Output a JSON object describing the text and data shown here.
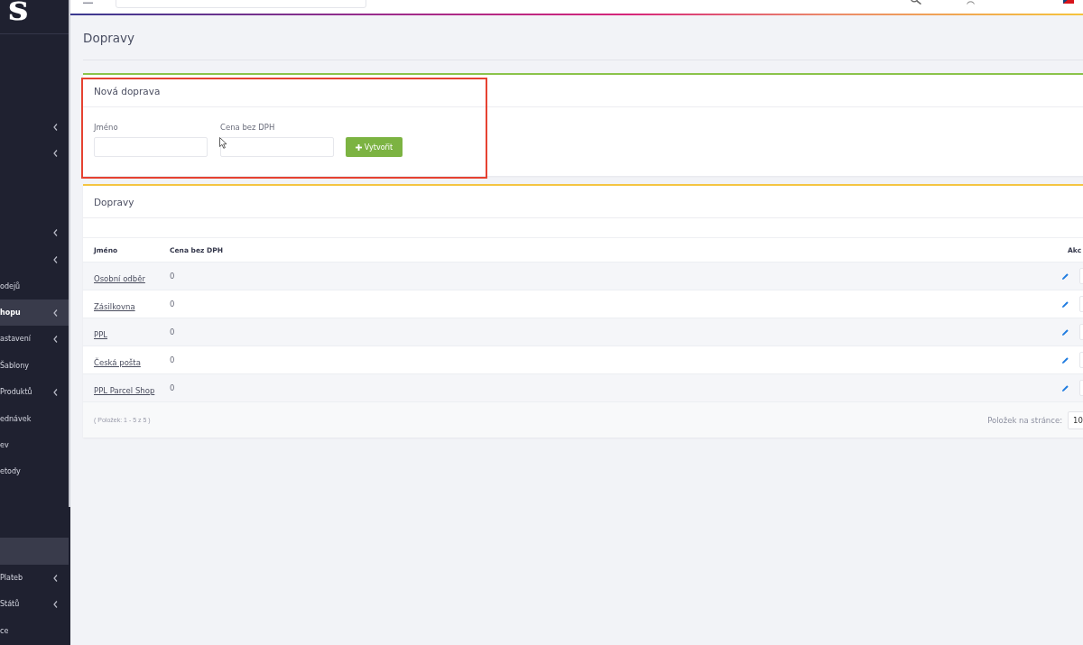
{
  "sidebar": {
    "logo": "s",
    "items": [
      {
        "expandable": true,
        "selected": false
      },
      {
        "expandable": true,
        "selected": false
      },
      {
        "expandable": true,
        "selected": false
      },
      {
        "expandable": true,
        "selected": false
      },
      {
        "label": "odejů",
        "expandable": false,
        "selected": false
      },
      {
        "label": "hopu",
        "expandable": true,
        "selected": true
      },
      {
        "label": "astavení",
        "expandable": true,
        "selected": false
      },
      {
        "label": "Šablony",
        "expandable": false,
        "selected": false
      },
      {
        "label": "Produktů",
        "expandable": true,
        "selected": false
      },
      {
        "label": "ednávek",
        "expandable": false,
        "selected": false
      },
      {
        "label": "ev",
        "expandable": false,
        "selected": false
      },
      {
        "label": "etody",
        "expandable": false,
        "selected": false
      },
      {
        "expandable": false,
        "selected": true
      },
      {
        "label": "Plateb",
        "expandable": true,
        "selected": false
      },
      {
        "label": "Států",
        "expandable": true,
        "selected": false
      },
      {
        "label": "ce",
        "expandable": false,
        "selected": false
      }
    ]
  },
  "page_title": "Dopravy",
  "new_form": {
    "title": "Nová doprava",
    "highlighted": true,
    "fields": [
      {
        "label": "Jméno"
      },
      {
        "label": "Cena bez DPH"
      }
    ],
    "submit": "Vytvořit"
  },
  "list": {
    "title": "Dopravy",
    "columns": [
      "Jméno",
      "Cena bez DPH",
      "Akc"
    ],
    "rows": [
      {
        "name": "Osobní odběr",
        "price": "0"
      },
      {
        "name": "Zásilkovna",
        "price": "0"
      },
      {
        "name": "PPL",
        "price": "0"
      },
      {
        "name": "Česká pošta",
        "price": "0"
      },
      {
        "name": "PPL Parcel Shop",
        "price": "0"
      }
    ],
    "footer": {
      "summary": "( Položek: 1 - 5 z 5 )",
      "per_page_label": "Položek na stránce:",
      "per_page": "10"
    }
  }
}
